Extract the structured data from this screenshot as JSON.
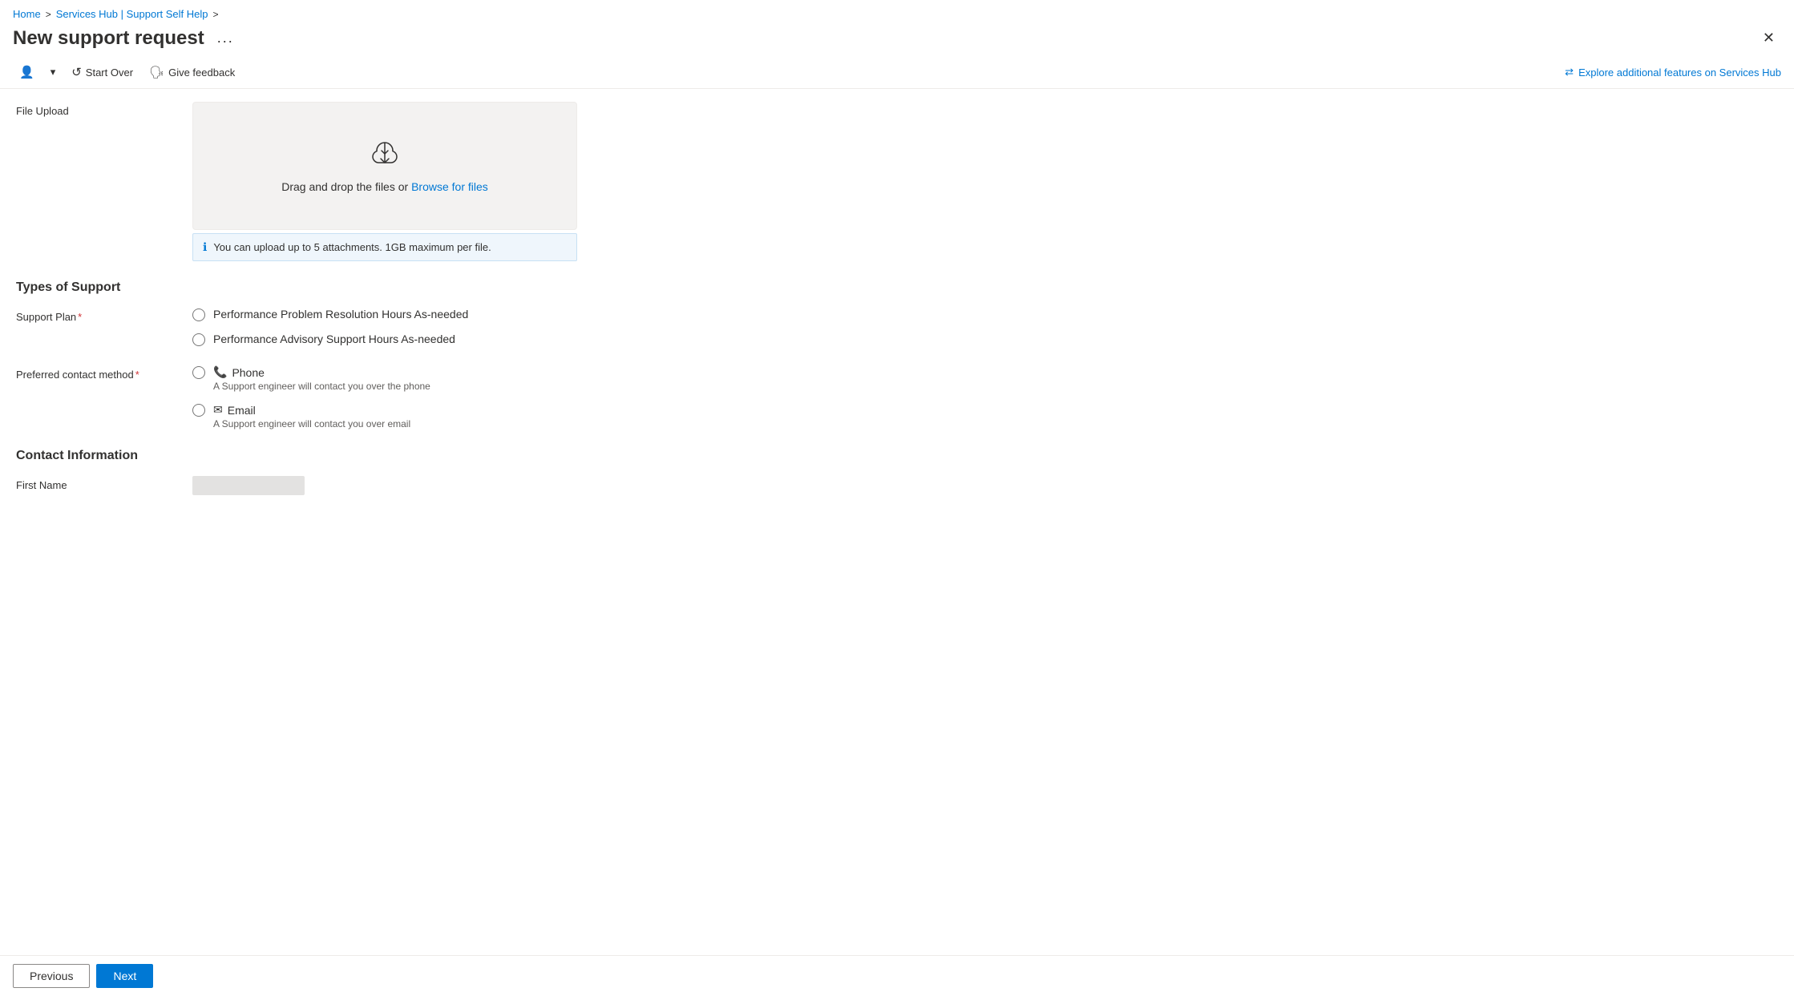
{
  "breadcrumb": {
    "home": "Home",
    "sep1": ">",
    "link": "Services Hub | Support Self Help",
    "sep2": ">"
  },
  "header": {
    "title": "New support request",
    "more_options": "...",
    "close": "✕"
  },
  "toolbar": {
    "user_icon": "👤",
    "dropdown_icon": "▾",
    "start_over_label": "Start Over",
    "feedback_label": "Give feedback",
    "explore_label": "Explore additional features on Services Hub"
  },
  "file_upload": {
    "label": "File Upload",
    "drag_text": "Drag and drop the files or",
    "browse_link": "Browse for files",
    "info_text": "You can upload up to 5 attachments. 1GB maximum per file."
  },
  "types_of_support": {
    "heading": "Types of Support",
    "support_plan_label": "Support Plan",
    "options": [
      {
        "id": "opt1",
        "label": "Performance Problem Resolution Hours As-needed"
      },
      {
        "id": "opt2",
        "label": "Performance Advisory Support Hours As-needed"
      }
    ]
  },
  "preferred_contact": {
    "label": "Preferred contact method",
    "options": [
      {
        "id": "phone",
        "icon": "📞",
        "label": "Phone",
        "desc": "A Support engineer will contact you over the phone"
      },
      {
        "id": "email",
        "icon": "✉",
        "label": "Email",
        "desc": "A Support engineer will contact you over email"
      }
    ]
  },
  "contact_info": {
    "heading": "Contact Information",
    "first_name_label": "First Name"
  },
  "nav": {
    "previous": "Previous",
    "next": "Next"
  }
}
